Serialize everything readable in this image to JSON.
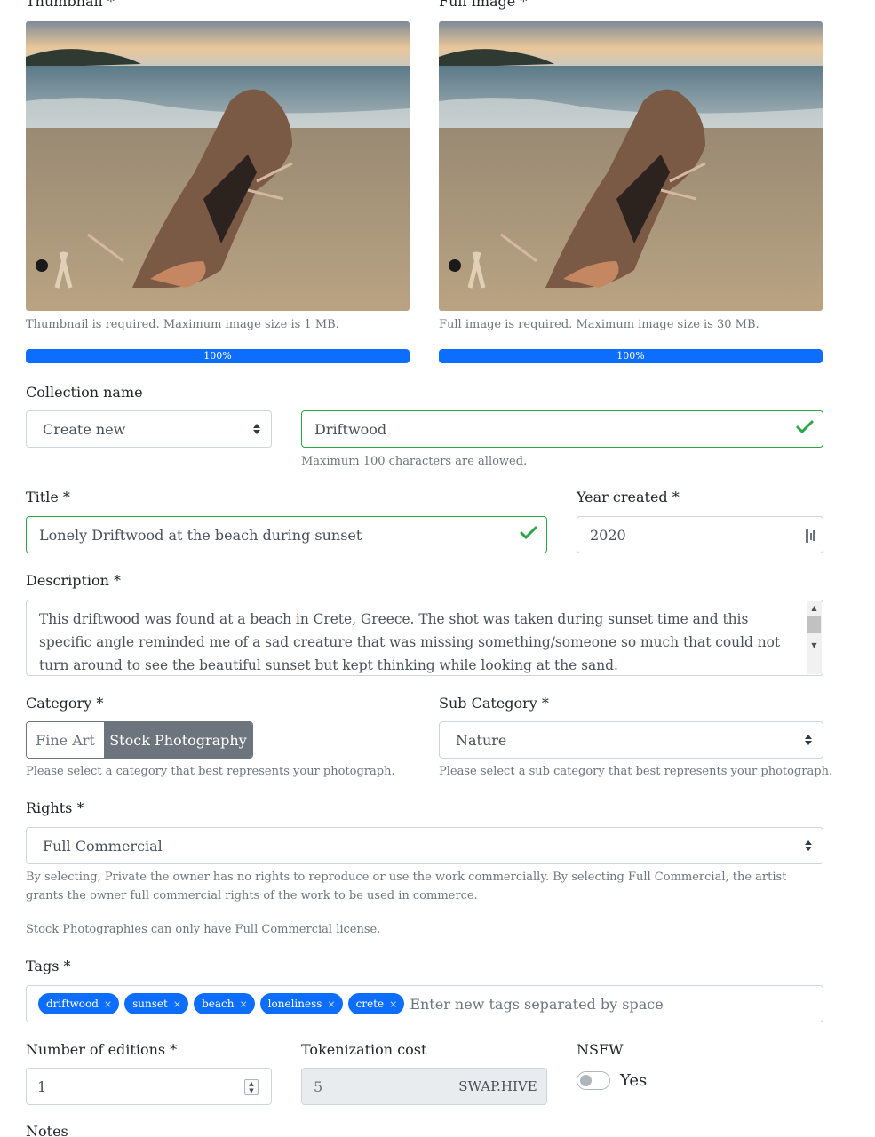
{
  "thumbnail": {
    "label": "Thumbnail *",
    "help": "Thumbnail is required. Maximum image size is 1 MB.",
    "progress_text": "100%",
    "progress": 1.0
  },
  "full_image": {
    "label": "Full image *",
    "help": "Full image is required. Maximum image size is 30 MB.",
    "progress_text": "100%",
    "progress": 1.0
  },
  "collection": {
    "label": "Collection name",
    "select_value": "Create new",
    "name_value": "Driftwood",
    "help": "Maximum 100 characters are allowed."
  },
  "title": {
    "label": "Title *",
    "value": "Lonely Driftwood at the beach during sunset"
  },
  "year": {
    "label": "Year created *",
    "value": "2020"
  },
  "description": {
    "label": "Description *",
    "value": "This driftwood was found at a beach in Crete, Greece. The shot was taken during sunset time and this specific angle reminded me of a sad creature that was missing something/someone so much that could not turn around to see the beautiful sunset but kept thinking while looking at the sand."
  },
  "category": {
    "label": "Category *",
    "options": [
      "Fine Art",
      "Stock Photography"
    ],
    "selected": "Stock Photography",
    "help": "Please select a category that best represents your photograph."
  },
  "sub_category": {
    "label": "Sub Category *",
    "value": "Nature",
    "help": "Please select a sub category that best represents your photograph."
  },
  "rights": {
    "label": "Rights *",
    "value": "Full Commercial",
    "help": "By selecting, Private the owner has no rights to reproduce or use the work commercially. By selecting Full Commercial, the artist grants the owner full commercial rights of the work to be used in commerce.",
    "note": "Stock Photographies can only have Full Commercial license."
  },
  "tags": {
    "label": "Tags *",
    "items": [
      "driftwood",
      "sunset",
      "beach",
      "loneliness",
      "crete"
    ],
    "remove_glyph": "×",
    "placeholder": "Enter new tags separated by space"
  },
  "editions": {
    "label": "Number of editions *",
    "value": "1"
  },
  "tokenization": {
    "label": "Tokenization cost",
    "value": "5",
    "unit": "SWAP.HIVE"
  },
  "nsfw": {
    "label": "NSFW",
    "toggle_label": "Yes",
    "enabled": false
  },
  "notes": {
    "label": "Notes"
  },
  "colors": {
    "valid": "#28a745",
    "primary": "#0d6efd",
    "selected_bg": "#6c757d"
  }
}
